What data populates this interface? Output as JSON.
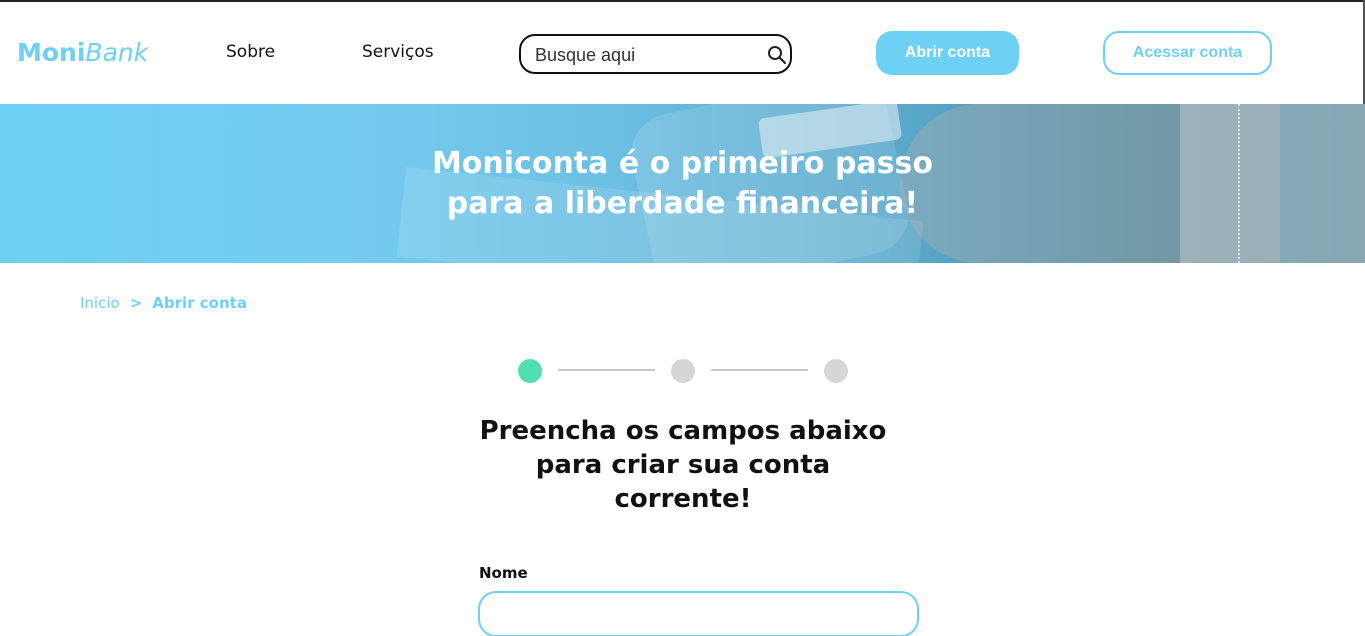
{
  "header": {
    "logo_part1": "Moni",
    "logo_part2": "Bank",
    "nav": [
      {
        "label": "Sobre"
      },
      {
        "label": "Serviços"
      }
    ],
    "search": {
      "placeholder": "Busque aqui",
      "icon": "search-icon"
    },
    "open_account_label": "Abrir conta",
    "access_account_label": "Acessar conta"
  },
  "hero": {
    "line1": "Moniconta é o primeiro passo",
    "line2": "para a liberdade financeira!"
  },
  "breadcrumb": {
    "home": "Inicio",
    "separator": ">",
    "current": "Abrir conta"
  },
  "stepper": {
    "total_steps": 3,
    "active_step": 1,
    "active_color": "#4fdfb0",
    "inactive_color": "#d6d6d6"
  },
  "form": {
    "title_line1": "Preencha os campos abaixo",
    "title_line2": "para criar sua conta",
    "title_line3": "corrente!",
    "name_label": "Nome",
    "name_value": ""
  },
  "colors": {
    "brand": "#6fd0f6",
    "text": "#111111"
  }
}
